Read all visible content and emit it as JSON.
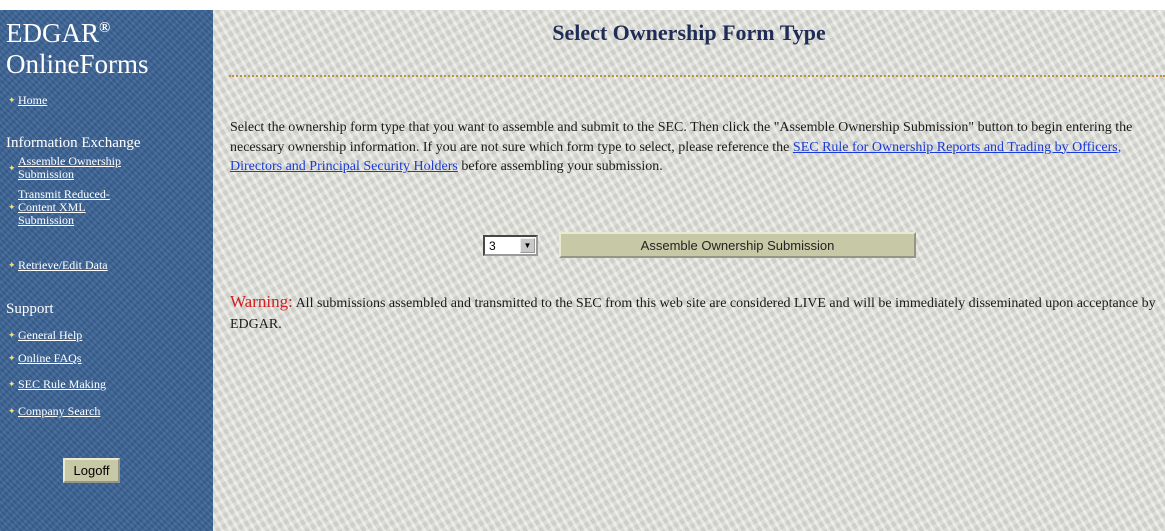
{
  "sidebar": {
    "brand_line1": "EDGAR",
    "brand_reg": "®",
    "brand_line2": "OnlineForms",
    "home": "Home",
    "info_exchange_heading": "Information Exchange",
    "assemble_ownership": "Assemble Ownership\nSubmission",
    "transmit_reduced": "Transmit Reduced-\nContent XML\nSubmission",
    "retrieve_edit": "Retrieve/Edit Data",
    "support_heading": "Support",
    "general_help": "General Help",
    "online_faqs": "Online FAQs",
    "sec_rule_making": "SEC Rule Making",
    "company_search": "Company Search",
    "logoff": "Logoff"
  },
  "main": {
    "title": "Select Ownership Form Type",
    "intro_part1": "Select the ownership form type that you want to assemble and submit to the SEC. Then click the \"Assemble Ownership Submission\" button to begin entering the necessary ownership information. If you are not sure which form type to select, please reference the ",
    "intro_link": "SEC Rule for Ownership Reports and Trading by Officers, Directors and Principal Security Holders",
    "intro_part2": " before assembling your submission.",
    "form_type_value": "3",
    "assemble_button": "Assemble Ownership Submission",
    "warning_label": "Warning:",
    "warning_text": " All submissions assembled and transmitted to the SEC from this web site are considered LIVE and will be immediately disseminated upon acceptance by EDGAR."
  },
  "colors": {
    "sidebar_bg": "#3a6294",
    "main_bg": "#dcdcd6",
    "title": "#1f2c55",
    "link": "#1b3bd6",
    "warning": "#d02020",
    "button": "#c7c9a6"
  }
}
